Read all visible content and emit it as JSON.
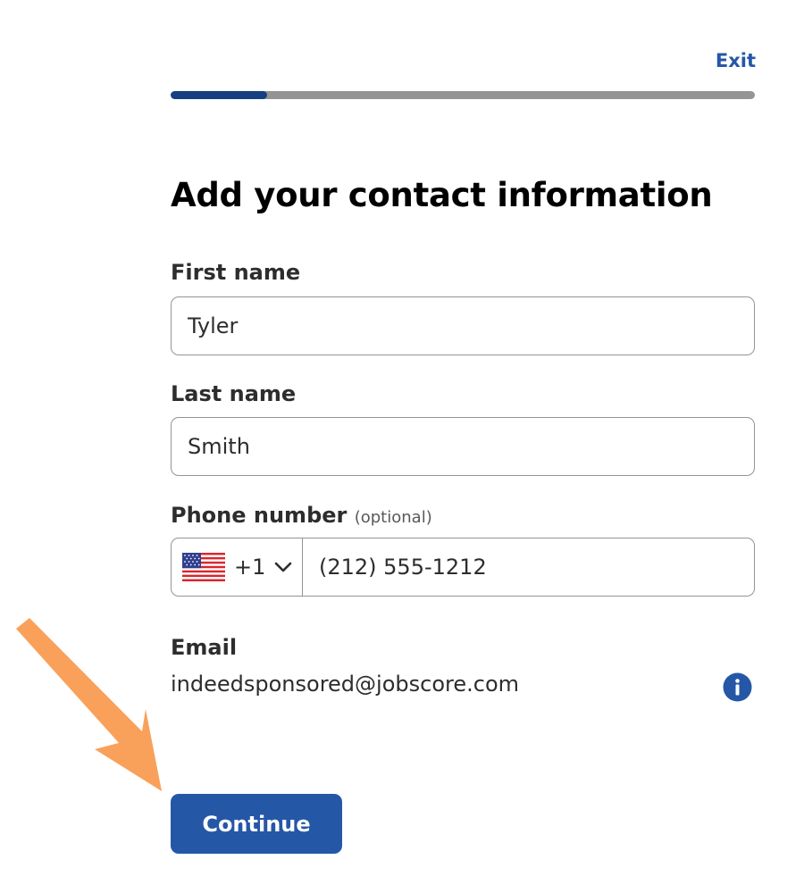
{
  "header": {
    "exit_label": "Exit",
    "progress_fraction": 0.165,
    "progress_color": "#164081",
    "track_color": "#949494"
  },
  "form": {
    "title": "Add your contact information",
    "first_name": {
      "label": "First name",
      "value": "Tyler"
    },
    "last_name": {
      "label": "Last name",
      "value": "Smith"
    },
    "phone": {
      "label": "Phone number",
      "optional_note": "(optional)",
      "country_icon": "us-flag-icon",
      "dial_code": "+1",
      "value": "(212) 555-1212"
    },
    "email": {
      "label": "Email",
      "value": "indeedsponsored@jobscore.com",
      "info_icon": "info-icon"
    },
    "continue_label": "Continue"
  },
  "colors": {
    "accent": "#2557a7",
    "annotation_arrow": "#f9a15a"
  }
}
